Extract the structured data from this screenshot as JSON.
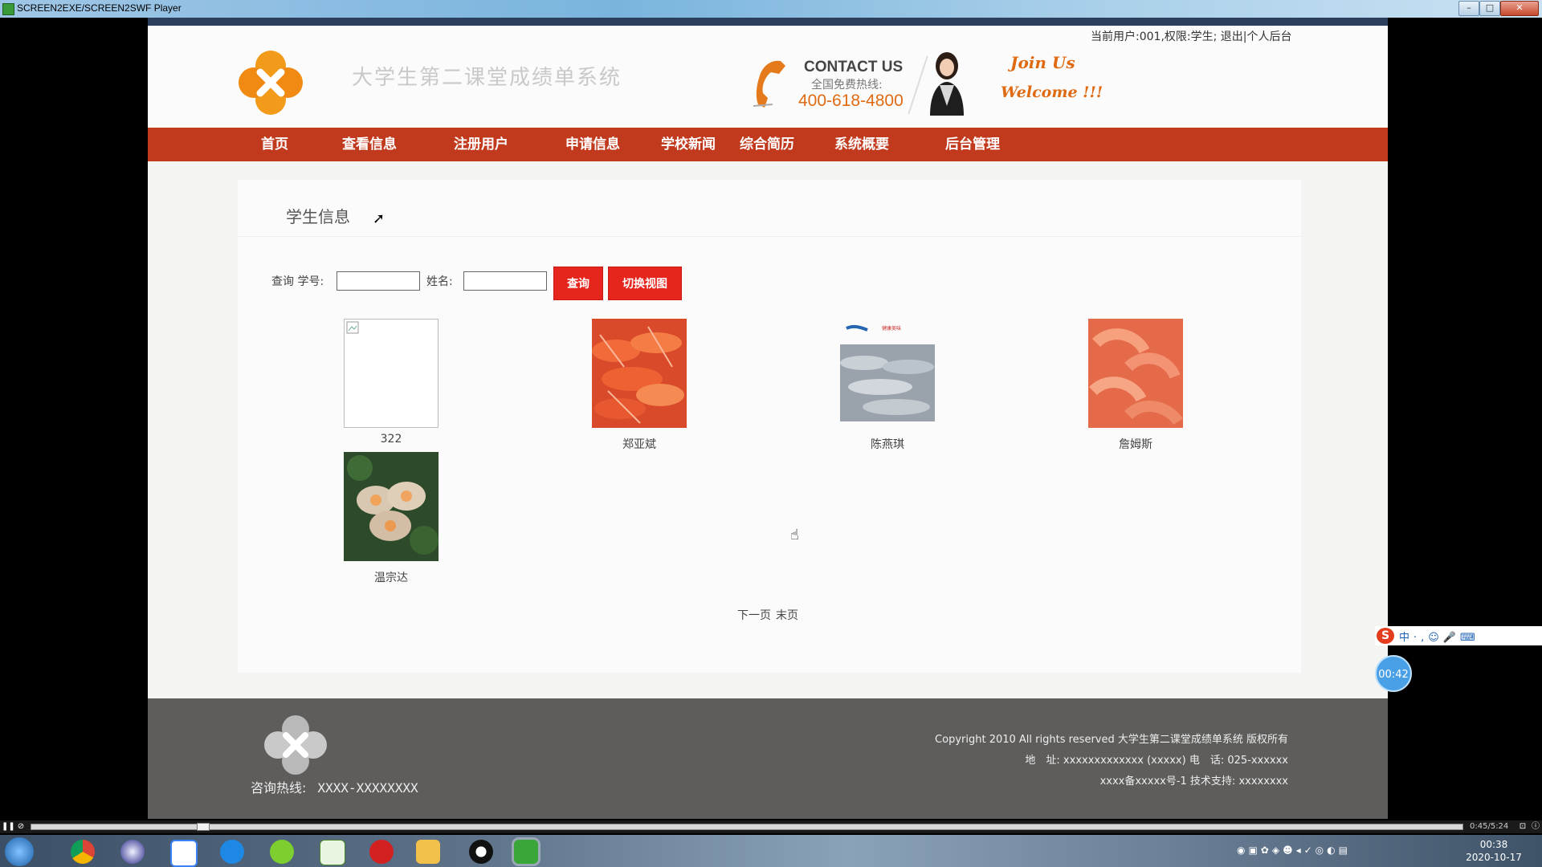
{
  "player": {
    "title": "SCREEN2EXE/SCREEN2SWF Player",
    "minimize_icon": "minimize-icon",
    "maximize_icon": "maximize-icon",
    "close_icon": "close-icon",
    "time": "0:45/5:24"
  },
  "header": {
    "site_title": "大学生第二课堂成绩单系统",
    "user_status": "当前用户:001,权限:学生; 退出|个人后台",
    "contact_title": "CONTACT US",
    "contact_sub": "全国免费热线:",
    "contact_phone": "400-618-4800",
    "join_title": "Join Us",
    "join_sub": "Welcome !!!"
  },
  "nav": {
    "items": [
      {
        "label": "首页"
      },
      {
        "label": "查看信息"
      },
      {
        "label": "注册用户"
      },
      {
        "label": "申请信息"
      },
      {
        "label": "学校新闻"
      },
      {
        "label": "综合简历"
      },
      {
        "label": "系统概要"
      },
      {
        "label": "后台管理"
      }
    ]
  },
  "content": {
    "title": "学生信息",
    "search": {
      "query_label": "查询 学号:",
      "name_label": "姓名:",
      "student_id_value": "",
      "name_value": "",
      "search_button": "查询",
      "switch_button": "切换视图"
    },
    "students": [
      {
        "name": "322",
        "image": "broken-image"
      },
      {
        "name": "郑亚斌",
        "image": "shrimp-photo"
      },
      {
        "name": "陈燕琪",
        "image": "fish-photo"
      },
      {
        "name": "詹姆斯",
        "image": "shrimp-photo"
      },
      {
        "name": "温宗达",
        "image": "scallop-photo"
      }
    ],
    "pager": {
      "next": "下一页",
      "last": "末页"
    }
  },
  "footer": {
    "hotline_label": "咨询热线:",
    "hotline_number": "XXXX-XXXXXXXX",
    "copyright": "Copyright 2010 All rights reserved 大学生第二课堂成绩单系统 版权所有",
    "address": "地　址: xxxxxxxxxxxxx (xxxxx) 电　话: 025-xxxxxx",
    "icp": "xxxx备xxxxx号-1 技术支持: xxxxxxxx"
  },
  "ime": {
    "logo": "S",
    "toolbar_text": "中·,☺🎤⌨"
  },
  "timer": "00:42",
  "clock": {
    "time": "00:38",
    "date": "2020-10-17"
  },
  "colors": {
    "nav_bg": "#c23a1d",
    "button_red": "#e6251d",
    "accent_orange": "#e06a12",
    "footer_bg": "#5e5d5c"
  }
}
